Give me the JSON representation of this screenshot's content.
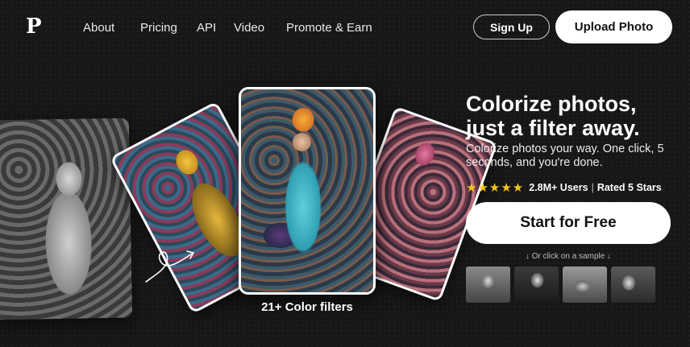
{
  "brand": {
    "logo": "P"
  },
  "nav": {
    "links": [
      "About",
      "Pricing",
      "API",
      "Video",
      "Promote & Earn"
    ],
    "signup_label": "Sign Up",
    "upload_label": "Upload Photo"
  },
  "hero": {
    "title_line1": "Colorize photos,",
    "title_line2": "just a filter away.",
    "subtitle": "Colorize photos your way. One click, 5 seconds, and you're done.",
    "stars": "★★★★★",
    "users": "2.8M+ Users",
    "separator": "|",
    "rated": "Rated 5 Stars",
    "cta_label": "Start for Free",
    "sample_hint": "↓ Or click on a sample ↓"
  },
  "showcase": {
    "caption": "21+ Color filters"
  },
  "icons": {
    "arrow": "curly-arrow-icon",
    "star": "star-icon"
  },
  "colors": {
    "background": "#171717",
    "star": "#f5c518",
    "button_bg": "#ffffff"
  }
}
